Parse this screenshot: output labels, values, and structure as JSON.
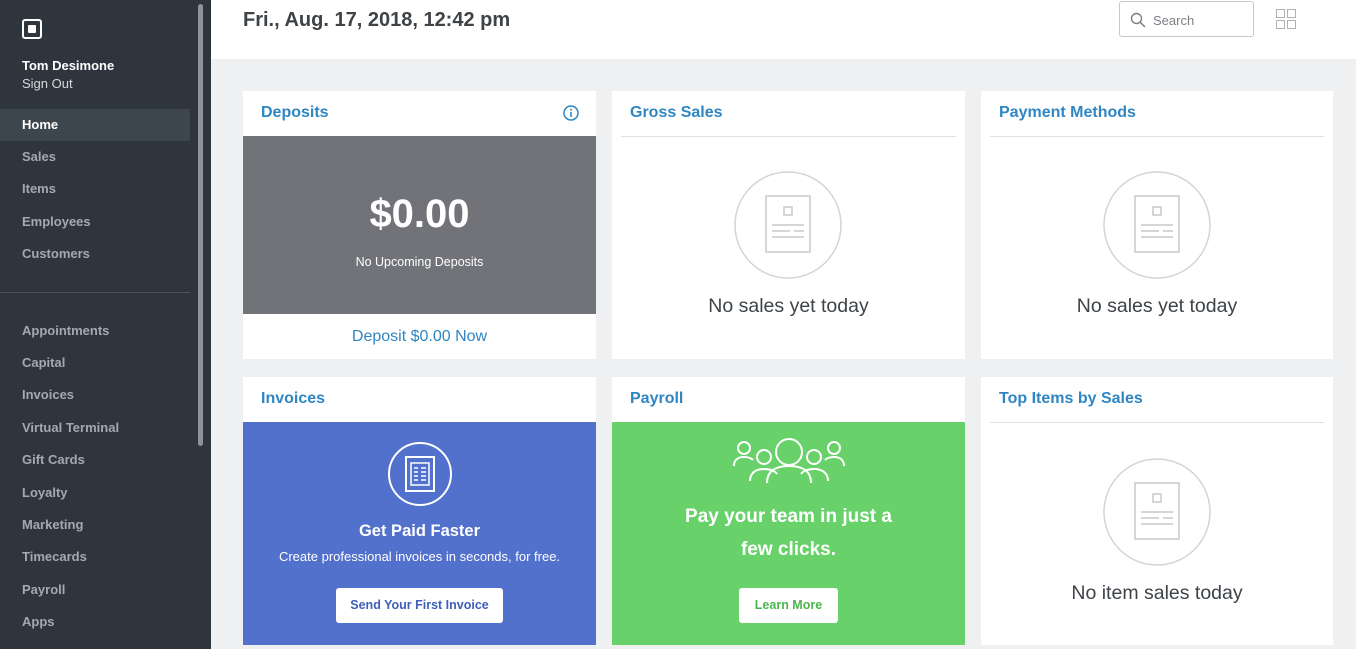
{
  "sidebar": {
    "user_name": "Tom Desimone",
    "sign_out": "Sign Out",
    "primary": [
      {
        "label": "Home",
        "active": true
      },
      {
        "label": "Sales"
      },
      {
        "label": "Items"
      },
      {
        "label": "Employees"
      },
      {
        "label": "Customers"
      }
    ],
    "secondary": [
      {
        "label": "Appointments"
      },
      {
        "label": "Capital"
      },
      {
        "label": "Invoices"
      },
      {
        "label": "Virtual Terminal"
      },
      {
        "label": "Gift Cards"
      },
      {
        "label": "Loyalty"
      },
      {
        "label": "Marketing"
      },
      {
        "label": "Timecards"
      },
      {
        "label": "Payroll"
      },
      {
        "label": "Apps"
      }
    ]
  },
  "header": {
    "title": "Fri., Aug. 17, 2018, 12:42 pm",
    "search_placeholder": "Search",
    "search_value": ""
  },
  "cards": {
    "deposits": {
      "title": "Deposits",
      "amount": "$0.00",
      "subtitle": "No Upcoming Deposits",
      "link": "Deposit $0.00 Now"
    },
    "gross_sales": {
      "title": "Gross Sales",
      "empty": "No sales yet today"
    },
    "payment_methods": {
      "title": "Payment Methods",
      "empty": "No sales yet today"
    },
    "invoices": {
      "title": "Invoices",
      "heading": "Get Paid Faster",
      "subtitle": "Create professional invoices in seconds, for free.",
      "button": "Send Your First Invoice"
    },
    "payroll": {
      "title": "Payroll",
      "heading_line1": "Pay your team in just a",
      "heading_line2": "few clicks.",
      "button": "Learn More"
    },
    "top_items": {
      "title": "Top Items by Sales",
      "empty": "No item sales today"
    }
  },
  "colors": {
    "accent": "#2f86c3",
    "sidebar_bg": "#2e353d",
    "deposit_panel": "#717379",
    "invoice_panel": "#5271cc",
    "payroll_panel": "#68d16a"
  }
}
